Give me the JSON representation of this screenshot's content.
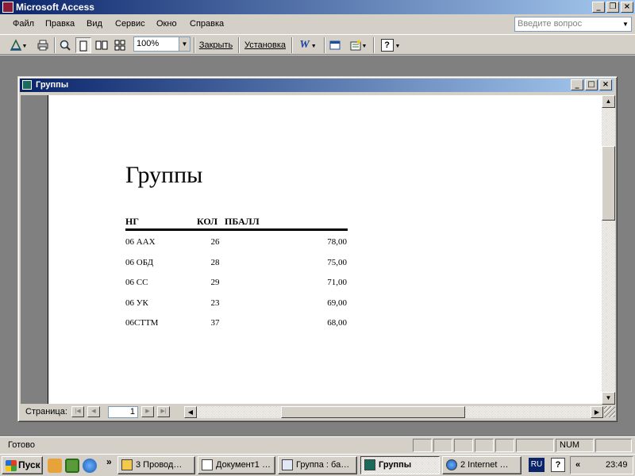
{
  "app": {
    "title": "Microsoft Access"
  },
  "menu": {
    "items": [
      "Файл",
      "Правка",
      "Вид",
      "Сервис",
      "Окно",
      "Справка"
    ],
    "help_placeholder": "Введите вопрос"
  },
  "toolbar": {
    "zoom": "100%",
    "close_label": "Закрыть",
    "setup_label": "Установка"
  },
  "child_window": {
    "title": "Группы"
  },
  "report": {
    "title": "Группы",
    "columns": [
      "НГ",
      "КОЛ",
      "ПБАЛЛ"
    ],
    "rows": [
      [
        "06 ААХ",
        "26",
        "78,00"
      ],
      [
        "06 ОБД",
        "28",
        "75,00"
      ],
      [
        "06 СС",
        "29",
        "71,00"
      ],
      [
        "06 УК",
        "23",
        "69,00"
      ],
      [
        "06СТТМ",
        "37",
        "68,00"
      ]
    ]
  },
  "navigation": {
    "label": "Страница:",
    "page": "1"
  },
  "status": {
    "text": "Готово",
    "num": "NUM"
  },
  "taskbar": {
    "start": "Пуск",
    "tasks": [
      {
        "label": "3 Провод…",
        "icon": "folder-icon"
      },
      {
        "label": "Документ1 …",
        "icon": "word-icon"
      },
      {
        "label": "Группа : ба…",
        "icon": "form-icon"
      },
      {
        "label": "Группы",
        "icon": "report-icon",
        "active": true
      },
      {
        "label": "2 Internet …",
        "icon": "ie-icon"
      }
    ],
    "lang": "RU",
    "time": "23:49"
  },
  "colors": {
    "title_start": "#0a246a",
    "title_end": "#a6caf0",
    "face": "#d4d0c8"
  }
}
